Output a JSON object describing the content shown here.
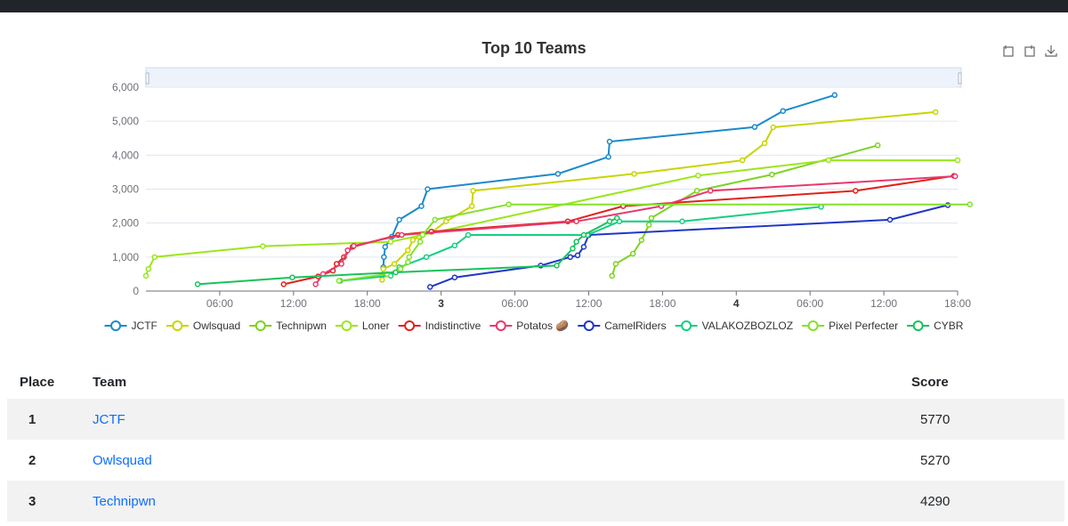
{
  "chart_data": {
    "type": "line",
    "title": "Top 10 Teams",
    "ylim": [
      0,
      6000
    ],
    "yticks": [
      0,
      1000,
      2000,
      3000,
      4000,
      5000,
      6000
    ],
    "ytick_labels": [
      "0",
      "1,000",
      "2,000",
      "3,000",
      "4,000",
      "5,000",
      "6,000"
    ],
    "xlim": [
      0,
      66
    ],
    "xticks": [
      6,
      12,
      18,
      24,
      30,
      36,
      42,
      48,
      54,
      60,
      66
    ],
    "xtick_labels": [
      "06:00",
      "12:00",
      "18:00",
      "3",
      "06:00",
      "12:00",
      "18:00",
      "4",
      "06:00",
      "12:00",
      "18:00"
    ],
    "legend_position": "bottom",
    "grid": true,
    "data_zoom_slider": true,
    "series": [
      {
        "name": "JCTF",
        "color": "#1a8bc8",
        "points": [
          [
            19.2,
            450
          ],
          [
            19.3,
            700
          ],
          [
            19.35,
            1000
          ],
          [
            19.45,
            1300
          ],
          [
            20,
            1600
          ],
          [
            20.6,
            2100
          ],
          [
            22.4,
            2500
          ],
          [
            22.9,
            3000
          ],
          [
            33.5,
            3450
          ],
          [
            37.6,
            3950
          ],
          [
            37.7,
            4400
          ],
          [
            49.5,
            4830
          ],
          [
            51.8,
            5300
          ],
          [
            56,
            5770
          ]
        ]
      },
      {
        "name": "Owlsquad",
        "color": "#c9d400",
        "points": [
          [
            19.2,
            330
          ],
          [
            19.3,
            650
          ],
          [
            20.2,
            800
          ],
          [
            21.3,
            1200
          ],
          [
            21.7,
            1500
          ],
          [
            22.2,
            1600
          ],
          [
            23.3,
            1750
          ],
          [
            24.4,
            2050
          ],
          [
            26.5,
            2500
          ],
          [
            26.6,
            2950
          ],
          [
            39.7,
            3450
          ],
          [
            48.5,
            3850
          ],
          [
            50.3,
            4350
          ],
          [
            51,
            4820
          ],
          [
            64.2,
            5270
          ]
        ]
      },
      {
        "name": "Technipwn",
        "color": "#7ed321",
        "points": [
          [
            37.9,
            450
          ],
          [
            38.2,
            800
          ],
          [
            39.6,
            1100
          ],
          [
            40.3,
            1500
          ],
          [
            40.9,
            1950
          ],
          [
            41.1,
            2150
          ],
          [
            44.8,
            2950
          ],
          [
            50.9,
            3430
          ],
          [
            59.5,
            4290
          ]
        ]
      },
      {
        "name": "Loner",
        "color": "#9be61c",
        "points": [
          [
            0,
            450
          ],
          [
            0.2,
            650
          ],
          [
            0.7,
            1000
          ],
          [
            9.5,
            1320
          ],
          [
            19.9,
            1450
          ],
          [
            44.9,
            3400
          ],
          [
            55.5,
            3850
          ],
          [
            66,
            3850
          ]
        ]
      },
      {
        "name": "Indistinctive",
        "color": "#e0231a",
        "points": [
          [
            11.2,
            200
          ],
          [
            14,
            430
          ],
          [
            15.2,
            600
          ],
          [
            15.5,
            800
          ],
          [
            16.1,
            1000
          ],
          [
            16.8,
            1300
          ],
          [
            20.5,
            1650
          ],
          [
            23.2,
            1750
          ],
          [
            34.3,
            2050
          ],
          [
            38.8,
            2500
          ],
          [
            57.7,
            2950
          ],
          [
            65.7,
            3390
          ]
        ]
      },
      {
        "name": "Potatos 🥔",
        "color": "#e8386d",
        "points": [
          [
            13.8,
            200
          ],
          [
            14.4,
            500
          ],
          [
            15.9,
            800
          ],
          [
            16.4,
            1200
          ],
          [
            16.9,
            1330
          ],
          [
            20.8,
            1650
          ],
          [
            35,
            2050
          ],
          [
            41.9,
            2500
          ],
          [
            45.9,
            2950
          ],
          [
            65.8,
            3380
          ]
        ]
      },
      {
        "name": "CamelRiders",
        "color": "#1f36c7",
        "points": [
          [
            23.1,
            120
          ],
          [
            25.1,
            400
          ],
          [
            32.1,
            750
          ],
          [
            34.5,
            1000
          ],
          [
            35.1,
            1050
          ],
          [
            35.6,
            1300
          ],
          [
            36,
            1650
          ],
          [
            60.5,
            2100
          ],
          [
            65.2,
            2530
          ]
        ]
      },
      {
        "name": "VALAKOZBOZLOZ",
        "color": "#14cf7f",
        "points": [
          [
            15.8,
            300
          ],
          [
            19.9,
            450
          ],
          [
            20.6,
            700
          ],
          [
            22.8,
            1000
          ],
          [
            25.1,
            1340
          ],
          [
            26.2,
            1650
          ],
          [
            35.9,
            1650
          ],
          [
            38.5,
            2050
          ],
          [
            43.6,
            2050
          ],
          [
            54.9,
            2480
          ]
        ]
      },
      {
        "name": "Pixel Perfecter",
        "color": "#84e12a",
        "points": [
          [
            15.7,
            300
          ],
          [
            19.6,
            500
          ],
          [
            20.7,
            650
          ],
          [
            21.3,
            850
          ],
          [
            21.4,
            1000
          ],
          [
            22.3,
            1450
          ],
          [
            22.5,
            1650
          ],
          [
            23.5,
            2100
          ],
          [
            29.5,
            2550
          ],
          [
            67,
            2550
          ]
        ]
      },
      {
        "name": "CYBR",
        "color": "#17c25a",
        "points": [
          [
            4.2,
            200
          ],
          [
            11.9,
            400
          ],
          [
            20.3,
            550
          ],
          [
            33.4,
            750
          ],
          [
            34.7,
            1250
          ],
          [
            35,
            1450
          ],
          [
            35.6,
            1650
          ],
          [
            37.7,
            2050
          ],
          [
            38.3,
            2150
          ]
        ]
      }
    ]
  },
  "toolbox": {
    "restore_icon": "restore-icon",
    "zoom_icon": "zoom-icon",
    "download_icon": "download-icon"
  },
  "scoreboard": {
    "headers": {
      "place": "Place",
      "team": "Team",
      "score": "Score"
    },
    "rows": [
      {
        "place": "1",
        "team": "JCTF",
        "score": "5770"
      },
      {
        "place": "2",
        "team": "Owlsquad",
        "score": "5270"
      },
      {
        "place": "3",
        "team": "Technipwn",
        "score": "4290"
      }
    ]
  }
}
